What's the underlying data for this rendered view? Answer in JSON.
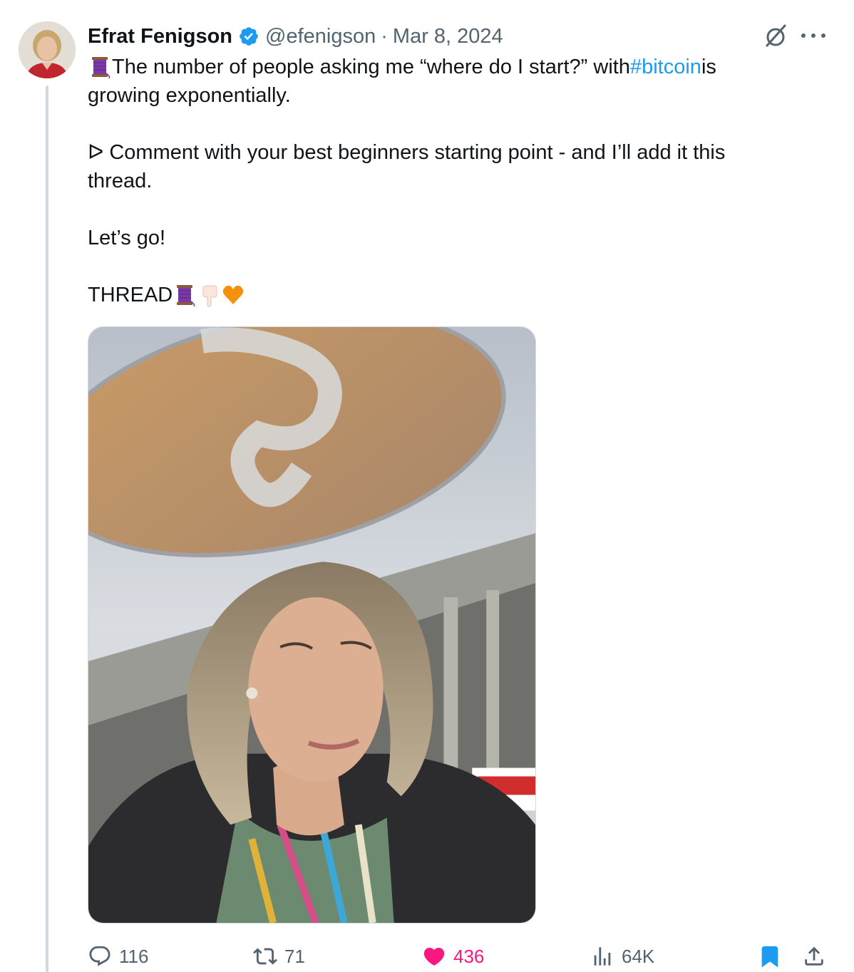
{
  "tweet": {
    "author": {
      "display_name": "Efrat Fenigson",
      "handle": "@efenigson",
      "verified": true
    },
    "separator": "·",
    "date": "Mar 8, 2024",
    "text": {
      "line1_before": "The number of people asking me “where do I start?” with ",
      "hashtag": "#bitcoin",
      "line1_after": " is",
      "line2": "growing exponentially.",
      "line4": "ᐅ Comment with your best beginners starting point - and I’ll add it this",
      "line5": "thread.",
      "line7": "Let’s go!",
      "line9": "THREAD"
    },
    "emojis": [
      "thread-spool-emoji",
      "thread-spool-emoji",
      "pointing-down-emoji",
      "orange-heart-emoji"
    ],
    "media": {
      "kind": "photo"
    },
    "stats": {
      "replies": "116",
      "reposts": "71",
      "likes": "436",
      "views": "64K"
    }
  },
  "colors": {
    "link": "#1d9bf0",
    "verified_badge": "#1d9bf0",
    "like_active": "#f91880",
    "bookmark_active": "#1d9bf0",
    "muted_text": "#536471",
    "thread_line": "#cfd9de"
  },
  "icons": [
    "reply-icon",
    "repost-icon",
    "like-icon",
    "views-icon",
    "bookmark-icon",
    "share-icon",
    "grok-icon",
    "more-icon",
    "verified-badge-icon"
  ]
}
